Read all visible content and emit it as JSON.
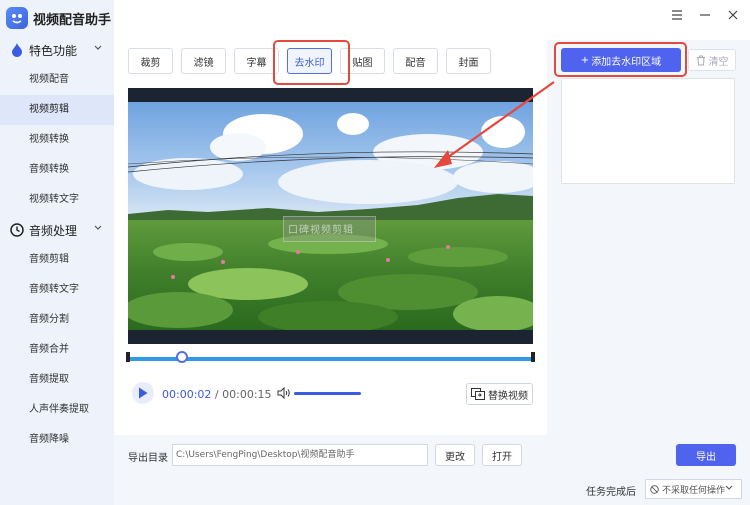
{
  "app": {
    "title": "视频配音助手"
  },
  "sidebar": {
    "groups": [
      {
        "label": "特色功能",
        "icon": "flame-icon",
        "items": [
          "视频配音",
          "视频剪辑",
          "视频转换",
          "音频转换",
          "视频转文字"
        ]
      },
      {
        "label": "音频处理",
        "icon": "clock-icon",
        "items": [
          "音频剪辑",
          "音频转文字",
          "音频分割",
          "音频合并",
          "音频提取",
          "人声伴奏提取",
          "音频降噪"
        ]
      }
    ],
    "active_item": "视频剪辑"
  },
  "window": {
    "controls": [
      "menu-icon",
      "minimize-icon",
      "close-icon"
    ]
  },
  "tabs": {
    "items": [
      "裁剪",
      "滤镜",
      "字幕",
      "去水印",
      "贴图",
      "配音",
      "封面"
    ],
    "active": "去水印"
  },
  "video": {
    "watermark_text": "口碑视频剪辑",
    "progress": 0.133
  },
  "player": {
    "current_time": "00:00:02",
    "separator": "/",
    "total_time": "00:00:15",
    "replace_label": "替换视频"
  },
  "watermark_panel": {
    "add_label": "添加去水印区域",
    "clear_label": "清空"
  },
  "output": {
    "dir_label": "导出目录",
    "path": "C:\\Users\\FengPing\\Desktop\\视频配音助手",
    "change_label": "更改",
    "open_label": "打开",
    "export_label": "导出"
  },
  "after_task": {
    "label": "任务完成后",
    "selected": "不采取任何操作"
  },
  "colors": {
    "accent": "#5063ef",
    "highlight": "#e5483d",
    "timeline": "#2f9be8"
  }
}
